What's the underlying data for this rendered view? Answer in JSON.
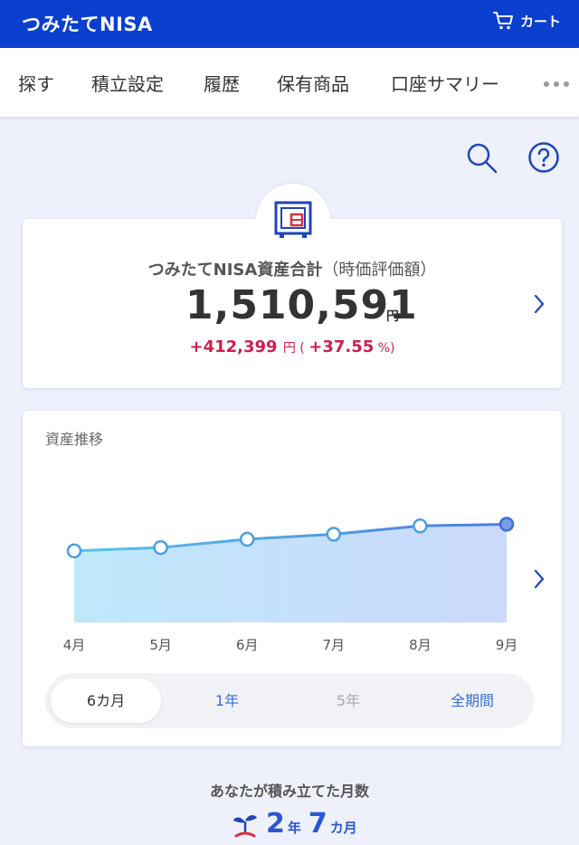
{
  "header": {
    "title": "つみたてNISA",
    "cart_label": "カート"
  },
  "tabs": [
    {
      "label": "探す"
    },
    {
      "label": "積立設定"
    },
    {
      "label": "履歴"
    },
    {
      "label": "保有商品"
    },
    {
      "label": "口座サマリー"
    }
  ],
  "asset": {
    "label": "つみたてNISA資産合計",
    "label_sub": "（時価評価額）",
    "value": "1,510,591",
    "unit": "円",
    "gain": "+412,399",
    "gain_unit": "円",
    "gain_pct_open": " ( ",
    "gain_pct": "+37.55",
    "gain_pct_close": " %)"
  },
  "chart_data": {
    "type": "area",
    "title": "資産推移",
    "categories": [
      "4月",
      "5月",
      "6月",
      "7月",
      "8月",
      "9月"
    ],
    "values": [
      0.43,
      0.45,
      0.5,
      0.53,
      0.58,
      0.59
    ],
    "accent_color": "#4aa0e0",
    "last_point_color": "#7b9be8"
  },
  "periods": [
    {
      "label": "6カ月",
      "state": "active"
    },
    {
      "label": "1年",
      "state": "enabled"
    },
    {
      "label": "5年",
      "state": "disabled"
    },
    {
      "label": "全期間",
      "state": "enabled"
    }
  ],
  "months": {
    "label": "あなたが積み立てた月数",
    "years": "2",
    "years_unit": "年",
    "months": "7",
    "months_unit": "カ月"
  },
  "colors": {
    "brand": "#0a3fd0",
    "gain": "#cc1f4e",
    "link": "#3a6dd8"
  }
}
